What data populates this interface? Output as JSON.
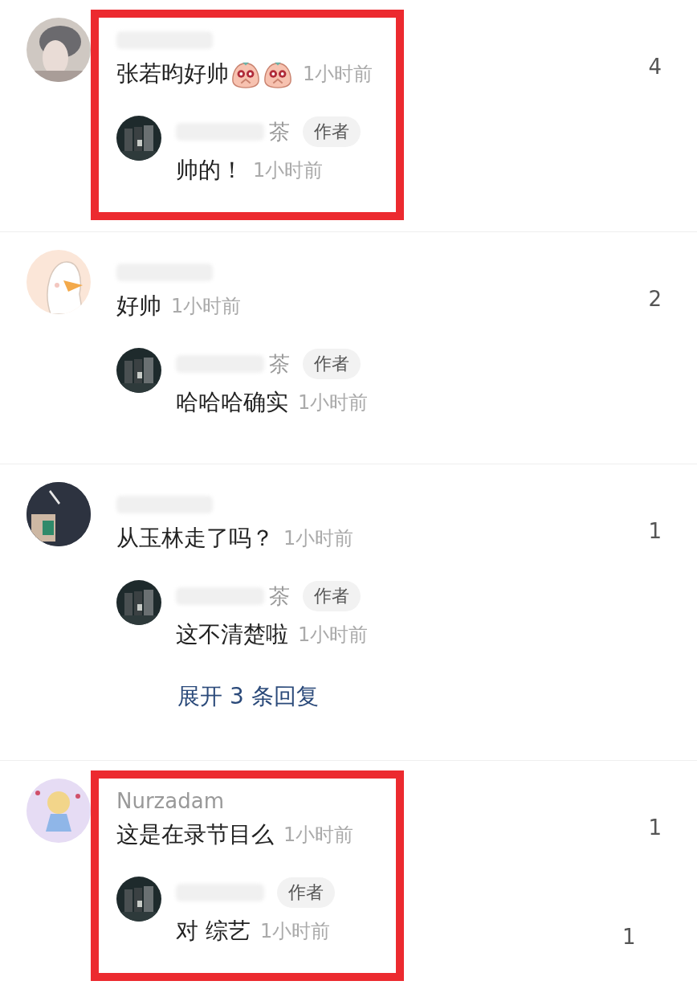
{
  "comments": [
    {
      "name_blurred": true,
      "text": "张若昀好帅",
      "stickers": [
        {
          "kind": "face"
        },
        {
          "kind": "face"
        }
      ],
      "time": "1小时前",
      "likes": "4",
      "highlighted": true,
      "replies": [
        {
          "name": "茶",
          "name_blurred": true,
          "badge": "作者",
          "text": "帅的！",
          "time": "1小时前"
        }
      ]
    },
    {
      "name_blurred": true,
      "text": "好帅",
      "time": "1小时前",
      "likes": "2",
      "highlighted": false,
      "replies": [
        {
          "name": "茶",
          "name_blurred": true,
          "badge": "作者",
          "text": "哈哈哈确实",
          "time": "1小时前"
        }
      ]
    },
    {
      "name_blurred": true,
      "text": "从玉林走了吗？",
      "time": "1小时前",
      "likes": "1",
      "highlighted": false,
      "replies": [
        {
          "name": "茶",
          "name_blurred": true,
          "badge": "作者",
          "text": "这不清楚啦",
          "time": "1小时前"
        }
      ],
      "expand": "展开 3 条回复"
    },
    {
      "name": "Nurzadam",
      "name_blurred": false,
      "text": "这是在录节目么",
      "time": "1小时前",
      "likes": "1",
      "highlighted": true,
      "replies": [
        {
          "name_blurred": true,
          "badge": "作者",
          "text": "对 综艺",
          "time": "1小时前",
          "likes": "1"
        }
      ]
    }
  ]
}
